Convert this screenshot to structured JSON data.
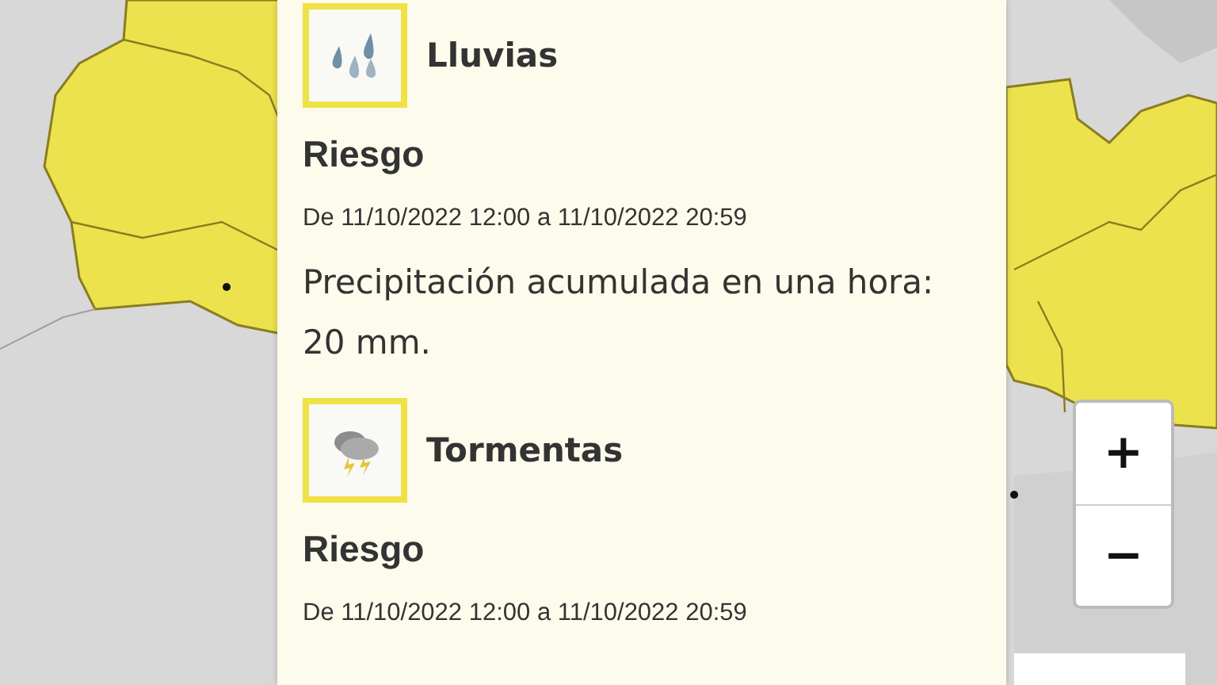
{
  "alerts": [
    {
      "kind": "rain",
      "title": "Lluvias",
      "level_label": "Riesgo",
      "period": "De 11/10/2022 12:00 a 11/10/2022 20:59",
      "description": "Precipitación acumulada en una hora: 20 mm."
    },
    {
      "kind": "storm",
      "title": "Tormentas",
      "level_label": "Riesgo",
      "period": "De 11/10/2022 12:00 a 11/10/2022 20:59"
    }
  ],
  "zoom_controls": {
    "zoom_in": "+",
    "zoom_out": "−"
  }
}
